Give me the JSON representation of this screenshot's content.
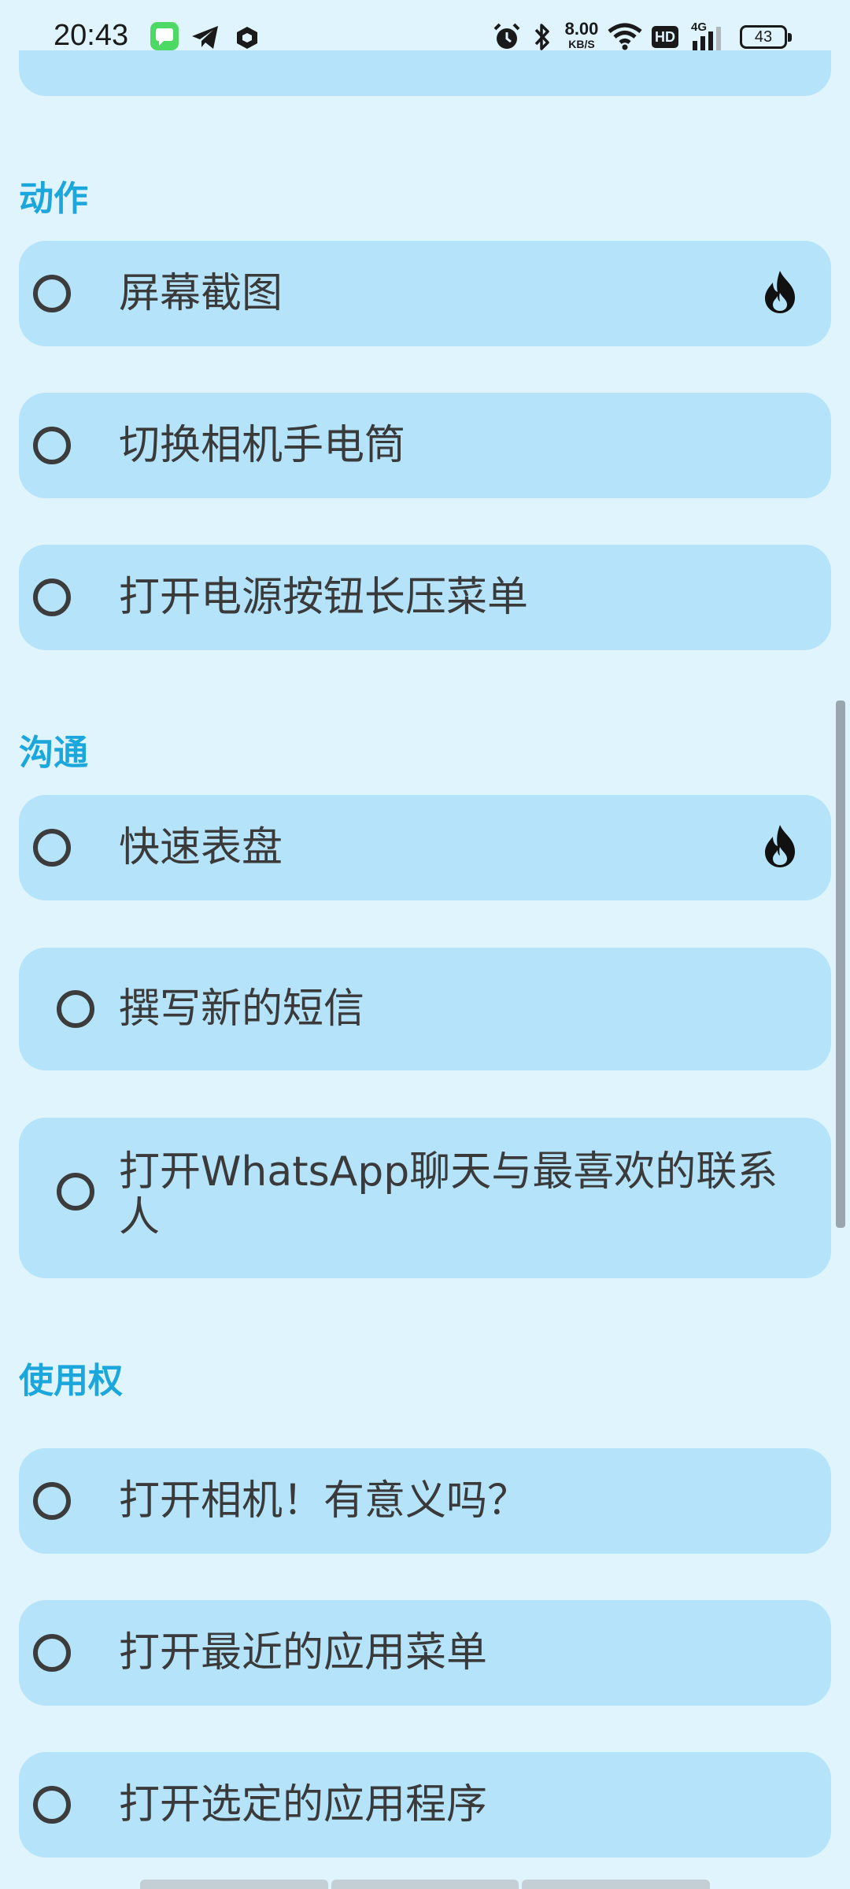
{
  "status_bar": {
    "time": "20:43",
    "net_speed_value": "8.00",
    "net_speed_unit": "KB/S",
    "hd_label": "HD",
    "signal_label": "4G",
    "battery": "43",
    "icons": [
      "messages-app-icon",
      "telegram-icon",
      "app-icon",
      "alarm-icon",
      "bluetooth-icon",
      "wifi-icon",
      "hd-icon",
      "signal-icon",
      "battery-icon"
    ]
  },
  "sections": [
    {
      "title": "动作",
      "items": [
        {
          "label": "屏幕截图",
          "hot": true
        },
        {
          "label": "切换相机手电筒",
          "hot": false
        },
        {
          "label": "打开电源按钮长压菜单",
          "hot": false
        }
      ]
    },
    {
      "title": "沟通",
      "items": [
        {
          "label": "快速表盘",
          "hot": true
        },
        {
          "label": "撰写新的短信",
          "hot": false
        },
        {
          "label": "打开WhatsApp聊天与最喜欢的联系人",
          "hot": false
        }
      ]
    },
    {
      "title": "使用权",
      "items": [
        {
          "label": "打开相机！有意义吗？",
          "hot": false
        },
        {
          "label": "打开最近的应用菜单",
          "hot": false
        },
        {
          "label": "打开选定的应用程序",
          "hot": false
        }
      ]
    }
  ],
  "colors": {
    "background": "#e0f4fd",
    "card": "#b5e3f9",
    "section_title": "#1ba6dc",
    "text": "#3a3a3a"
  }
}
